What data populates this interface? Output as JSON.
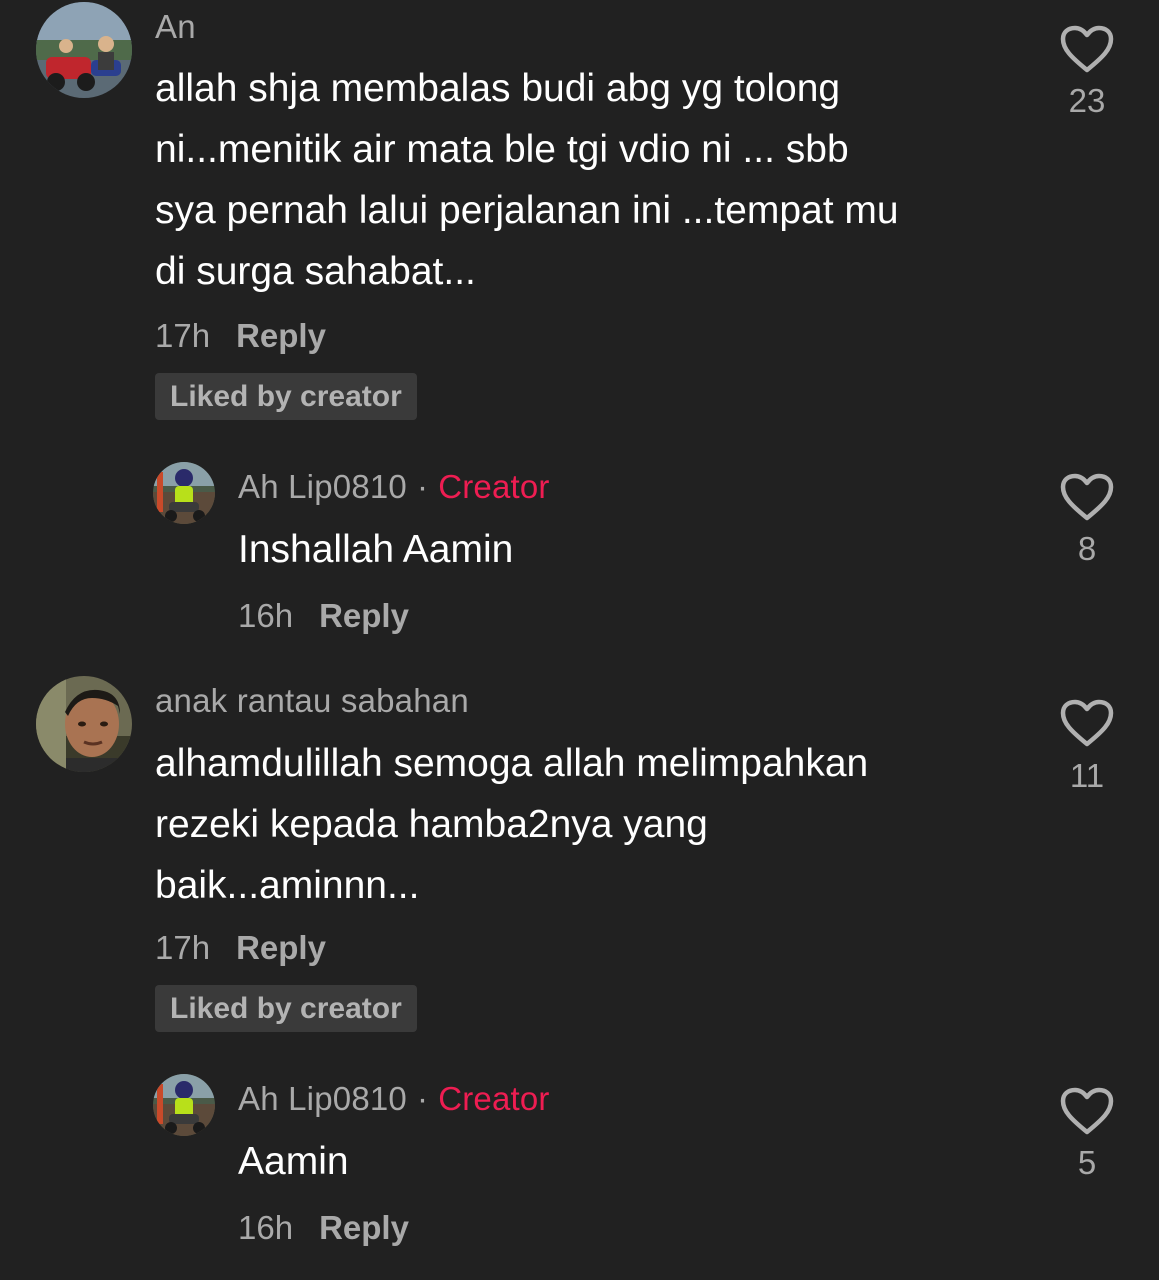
{
  "comments": [
    {
      "username": "An",
      "lines": [
        "allah shja membalas budi abg yg tolong",
        "ni...menitik air mata ble tgi vdio ni ... sbb",
        "sya pernah lalui perjalanan ini ...tempat mu",
        "di surga sahabat..."
      ],
      "time": "17h",
      "reply_label": "Reply",
      "badge": "Liked by creator",
      "likes": "23",
      "reply": {
        "username": "Ah Lip0810",
        "separator": "·",
        "creator_label": "Creator",
        "text": "Inshallah Aamin",
        "time": "16h",
        "reply_label": "Reply",
        "likes": "8"
      }
    },
    {
      "username": "anak rantau sabahan",
      "lines": [
        "alhamdulillah semoga allah melimpahkan",
        "rezeki kepada hamba2nya yang",
        "baik...aminnn..."
      ],
      "time": "17h",
      "reply_label": "Reply",
      "badge": "Liked by creator",
      "likes": "11",
      "reply": {
        "username": "Ah Lip0810",
        "separator": "·",
        "creator_label": "Creator",
        "text": "Aamin",
        "time": "16h",
        "reply_label": "Reply",
        "likes": "5"
      }
    }
  ],
  "icons": {
    "like": "heart-outline-icon"
  },
  "colors": {
    "background": "#212121",
    "creator": "#ee1d52",
    "secondary_text": "#a9a9a9",
    "badge_bg": "#3a3a3a"
  }
}
